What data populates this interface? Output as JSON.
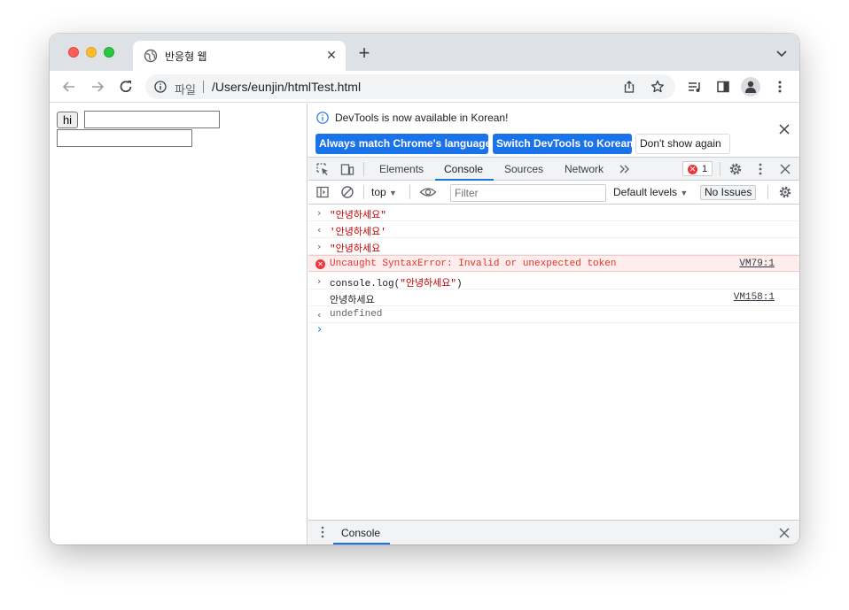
{
  "browser": {
    "tab_title": "반응형 웹",
    "address": {
      "scheme_label": "파일",
      "url": "/Users/eunjin/htmlTest.html"
    }
  },
  "page": {
    "button_label": "hi"
  },
  "devtools": {
    "infobar": {
      "message": "DevTools is now available in Korean!",
      "btn_match": "Always match Chrome's language",
      "btn_switch": "Switch DevTools to Korean",
      "btn_dismiss": "Don't show again"
    },
    "tabs": [
      "Elements",
      "Console",
      "Sources",
      "Network"
    ],
    "active_tab": "Console",
    "error_count": "1",
    "console_toolbar": {
      "context": "top",
      "filter_placeholder": "Filter",
      "levels": "Default levels",
      "issues": "No Issues"
    },
    "console_lines": [
      {
        "kind": "input",
        "text": "\"안녕하세요\"",
        "source": ""
      },
      {
        "kind": "result",
        "text": "'안녕하세요'",
        "source": ""
      },
      {
        "kind": "input",
        "text": "\"안녕하세요",
        "source": ""
      },
      {
        "kind": "error",
        "text": "Uncaught SyntaxError: Invalid or unexpected token",
        "source": "VM79:1"
      },
      {
        "kind": "input",
        "text": "console.log(\"안녕하세요\")",
        "source": ""
      },
      {
        "kind": "log",
        "text": "안녕하세요",
        "source": "VM158:1"
      },
      {
        "kind": "result",
        "text": "undefined",
        "source": ""
      }
    ],
    "drawer_tab": "Console"
  },
  "colors": {
    "accent": "#1a73e8",
    "error": "#e8373e",
    "string": "#c80000"
  }
}
